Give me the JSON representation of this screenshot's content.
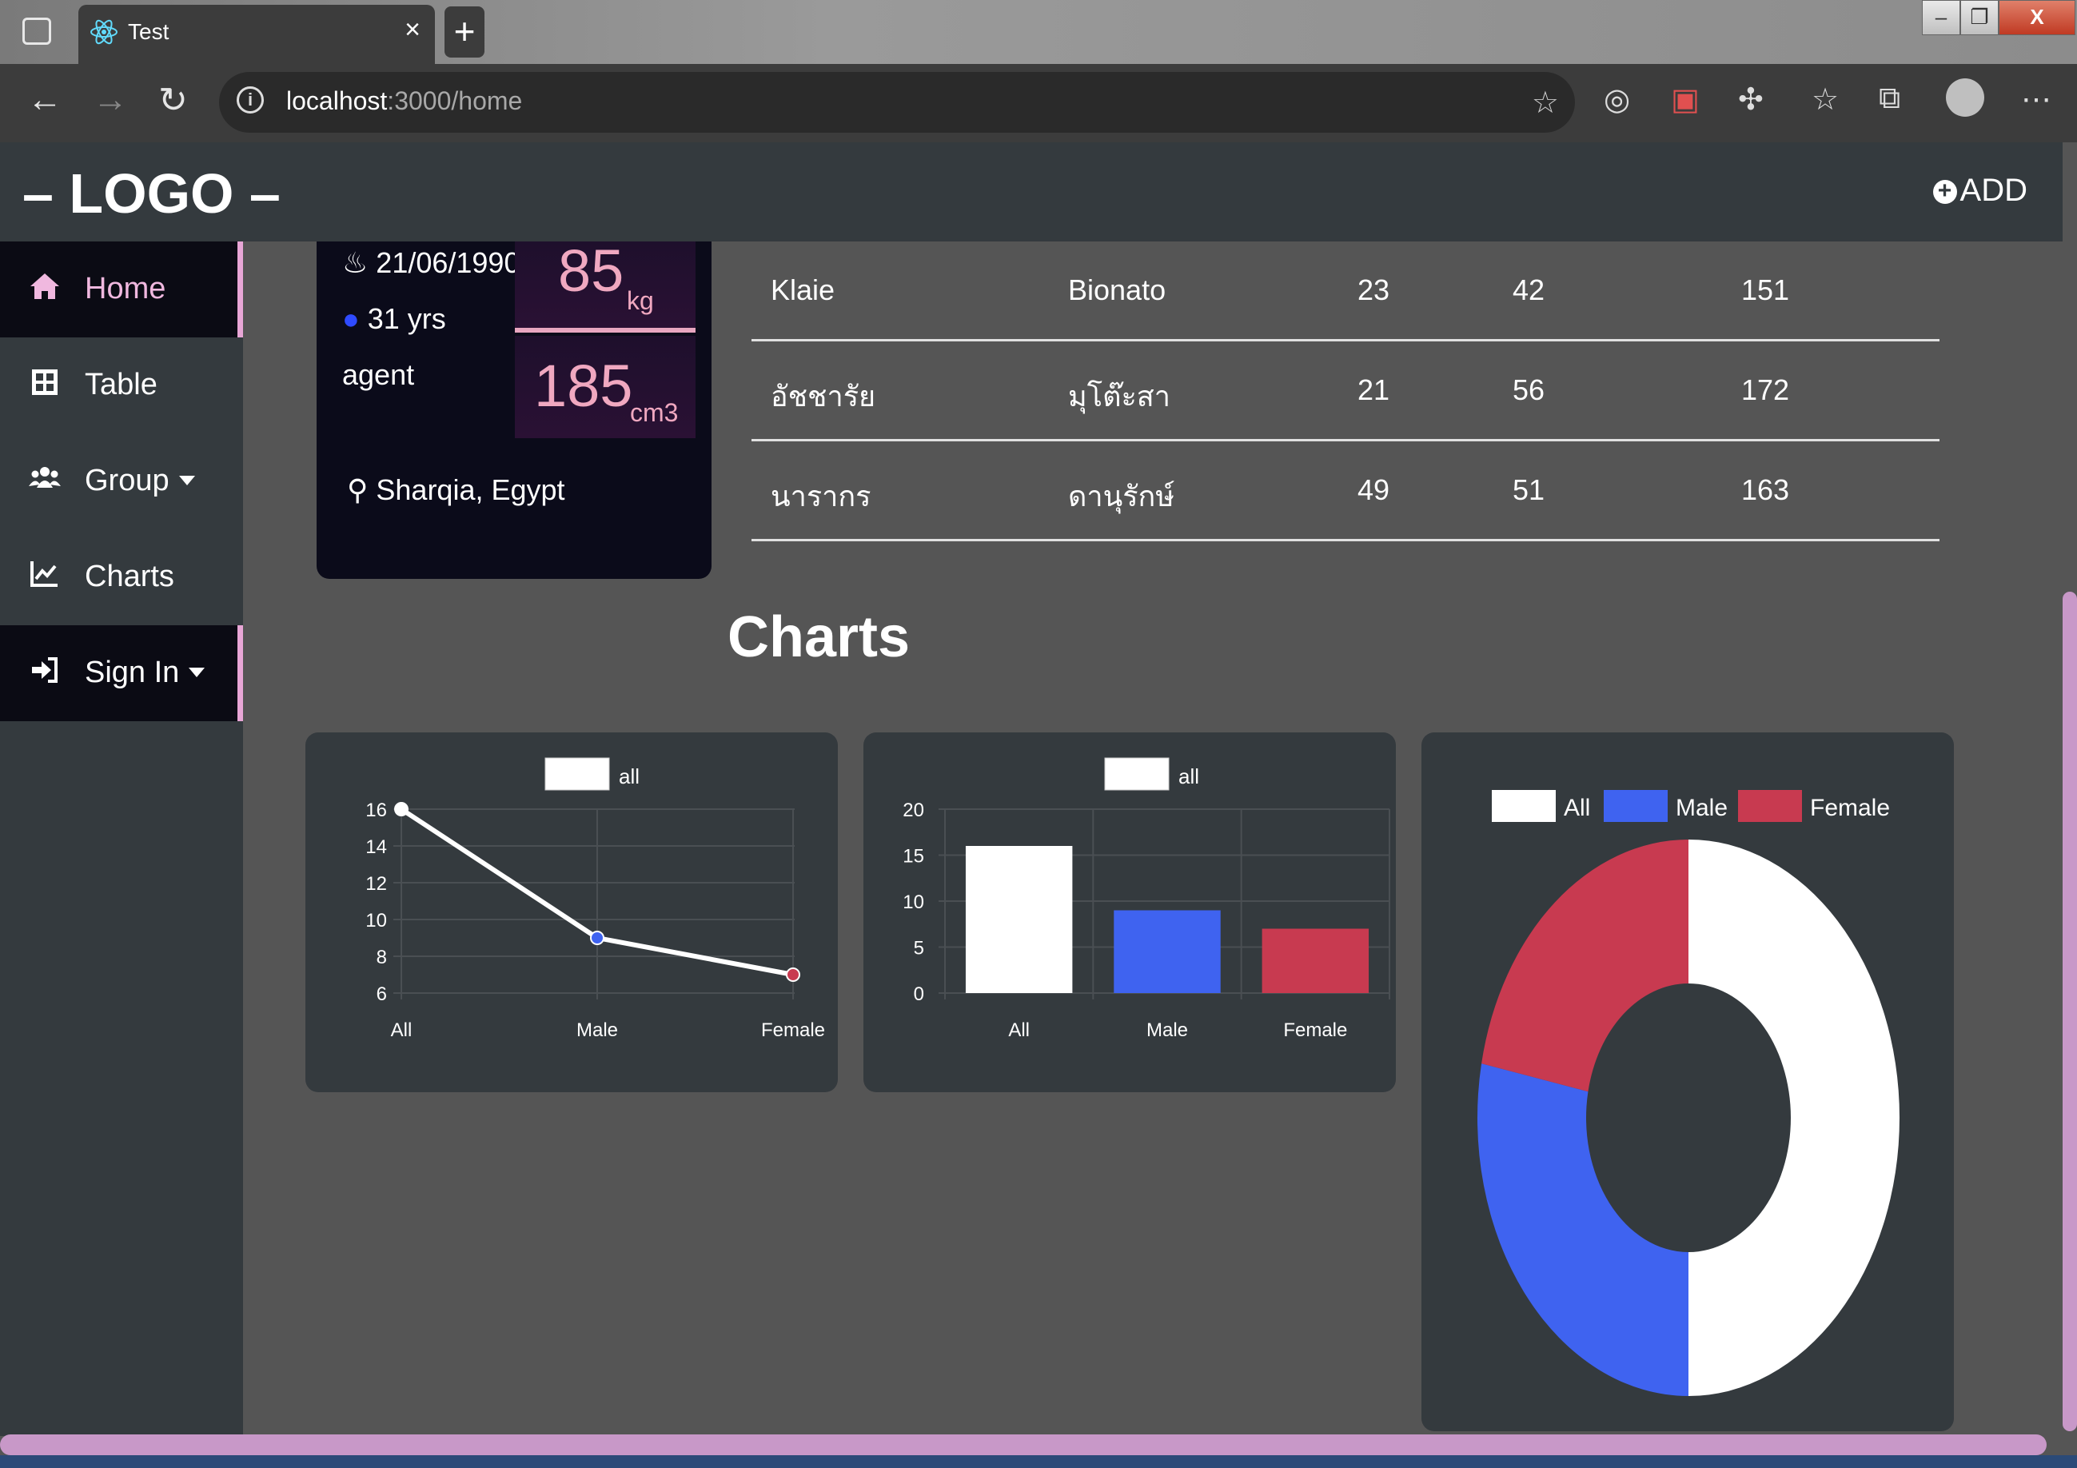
{
  "browser": {
    "tab_title": "Test",
    "url_host": "localhost",
    "url_path": ":3000/home"
  },
  "header": {
    "logo": "– LOGO –",
    "add_label": "ADD"
  },
  "sidebar": {
    "items": [
      {
        "label": "Home",
        "icon": "home-icon"
      },
      {
        "label": "Table",
        "icon": "table-icon"
      },
      {
        "label": "Group",
        "icon": "users-icon"
      },
      {
        "label": "Charts",
        "icon": "chart-line-icon"
      },
      {
        "label": "Sign In",
        "icon": "sign-in-icon"
      }
    ]
  },
  "profile": {
    "dob": "21/06/1990",
    "age": "31 yrs",
    "role": "agent",
    "weight": "85",
    "weight_unit": "kg",
    "height": "185",
    "height_unit": "cm3",
    "location": "Sharqia, Egypt"
  },
  "table": {
    "rows": [
      [
        "Klaie",
        "Bionato",
        "23",
        "42",
        "151"
      ],
      [
        "อัชชารัย",
        "มุโต๊ะสา",
        "21",
        "56",
        "172"
      ],
      [
        "นารากร",
        "ดานุรักษ์",
        "49",
        "51",
        "163"
      ]
    ]
  },
  "charts_heading": "Charts",
  "colors": {
    "all": "#ffffff",
    "male": "#3f63f0",
    "female": "#c83a50",
    "accent": "#e8a6d6"
  },
  "chart_data": [
    {
      "type": "line",
      "categories": [
        "All",
        "Male",
        "Female"
      ],
      "series": [
        {
          "name": "all",
          "values": [
            16,
            9,
            7
          ]
        }
      ],
      "ylim": [
        6,
        16
      ],
      "yticks": [
        6,
        8,
        10,
        12,
        14,
        16
      ]
    },
    {
      "type": "bar",
      "categories": [
        "All",
        "Male",
        "Female"
      ],
      "series": [
        {
          "name": "all",
          "values": [
            16,
            9,
            7
          ]
        }
      ],
      "ylim": [
        0,
        20
      ],
      "yticks": [
        0,
        5,
        10,
        15,
        20
      ]
    },
    {
      "type": "pie",
      "labels": [
        "All",
        "Male",
        "Female"
      ],
      "values": [
        16,
        9,
        7
      ]
    }
  ]
}
